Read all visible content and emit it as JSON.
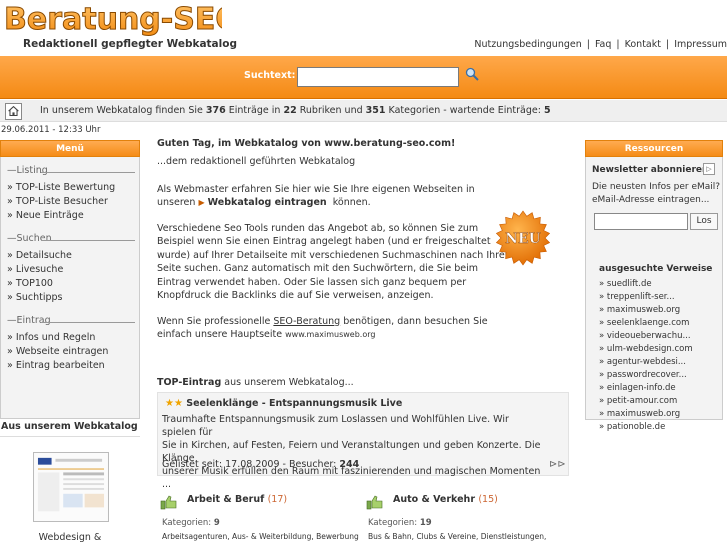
{
  "header": {
    "logo_text": "Beratung-SEO",
    "tagline": "Redaktionell gepflegter Webkatalog",
    "nav": [
      "Nutzungsbedingungen",
      "Faq",
      "Kontakt",
      "Impressum"
    ]
  },
  "search": {
    "label": "Suchtext:",
    "value": ""
  },
  "info": {
    "pre": "In unserem Webkatalog finden Sie",
    "entries": "376",
    "mid1": "Einträge in",
    "rubrics": "22",
    "mid2": "Rubriken und",
    "categories": "351",
    "mid3": "Kategorien - wartende Einträge:",
    "waiting": "5"
  },
  "date": "29.06.2011 - 12:33 Uhr",
  "menu": {
    "title": "Menü",
    "groups": [
      {
        "name": "Listing",
        "items": [
          "» TOP-Liste Bewertung",
          "» TOP-Liste Besucher",
          "» Neue Einträge"
        ]
      },
      {
        "name": "Suchen",
        "items": [
          "» Detailsuche",
          "» Livesuche",
          "» TOP100",
          "» Suchtipps"
        ]
      },
      {
        "name": "Eintrag",
        "items": [
          "» Infos und Regeln",
          "» Webseite eintragen",
          "» Eintrag bearbeiten"
        ]
      }
    ]
  },
  "aus": {
    "title": "Aus unserem Webkatalog",
    "caption": "Webdesign &"
  },
  "main": {
    "greeting": "Guten Tag, im Webkatalog von www.beratung-seo.com!",
    "sub": "...dem redaktionell geführten Webkatalog",
    "p1a": "Als Webmaster erfahren Sie hier wie Sie Ihre eigenen Webseiten in",
    "p1b_pre": "unseren",
    "p1b_link": "Webkatalog eintragen",
    "p1b_post": "können.",
    "p2": [
      "Verschiedene Seo Tools runden das Angebot ab, so können Sie zum",
      "Beispiel wenn Sie einen Eintrag angelegt haben (und er freigeschaltet",
      "wurde) auf Ihrer Detailseite mit verschiedenen Suchmaschinen nach Ihrer",
      "Seite suchen. Ganz automatisch mit den Suchwörtern, die Sie beim",
      "Eintrag verwendet haben. Oder Sie lassen sich ganz bequem per",
      "Knopfdruck die Backlinks die auf Sie verweisen, anzeigen."
    ],
    "p3a_pre": "Wenn Sie professionelle",
    "p3a_link": "SEO-Beratung",
    "p3a_post": "benötigen, dann besuchen Sie",
    "p3b_pre": "einfach unsere Hauptseite",
    "p3b_link": "www.maximusweb.org",
    "neu_badge": "NEU"
  },
  "top": {
    "heading_bold": "TOP-Eintrag",
    "heading_rest": "aus unserem Webkatalog...",
    "stars": "★★",
    "title": "Seelenklänge - Entspannungsmusik Live",
    "desc": [
      "Traumhafte Entspannungsmusik zum Loslassen und Wohlfühlen Live. Wir spielen für",
      "Sie in Kirchen, auf Festen, Feiern und Veranstaltungen und geben Konzerte. Die Klänge",
      "unserer Musik erfüllen den Raum mit faszinierenden und magischen Momenten ..."
    ],
    "listed_label": "Gelistet seit: 17.08.2009 - Besucher:",
    "visitors": "244",
    "next": "⊳⊳"
  },
  "categories": [
    {
      "title": "Arbeit & Beruf",
      "count": "(17)",
      "kat_label": "Kategorien:",
      "kat_count": "9",
      "sub": "Arbeitsagenturen, Aus- & Weiterbildung, Bewerbung"
    },
    {
      "title": "Auto & Verkehr",
      "count": "(15)",
      "kat_label": "Kategorien:",
      "kat_count": "19",
      "sub": "Bus & Bahn, Clubs & Vereine, Dienstleistungen,"
    }
  ],
  "resources": {
    "title": "Ressourcen",
    "nl_title": "Newsletter abonnieren",
    "nl_text": [
      "Die neusten Infos per eMail?",
      "eMail-Adresse eintragen..."
    ],
    "nl_button": "Los",
    "av_title": "ausgesuchte Verweise",
    "av_items": [
      "» suedlift.de",
      "» treppenlift-ser...",
      "» maximusweb.org",
      "» seelenklaenge.com",
      "» videoueberwachu...",
      "» ulm-webdesign.com",
      "» agentur-webdesi...",
      "» passwordrecover...",
      "» einlagen-info.de",
      "» petit-amour.com",
      "» maximusweb.org",
      "» pationoble.de"
    ]
  },
  "colors": {
    "accent": "#f48a14",
    "logo_orange": "#f7931e",
    "star": "#f0a400"
  }
}
